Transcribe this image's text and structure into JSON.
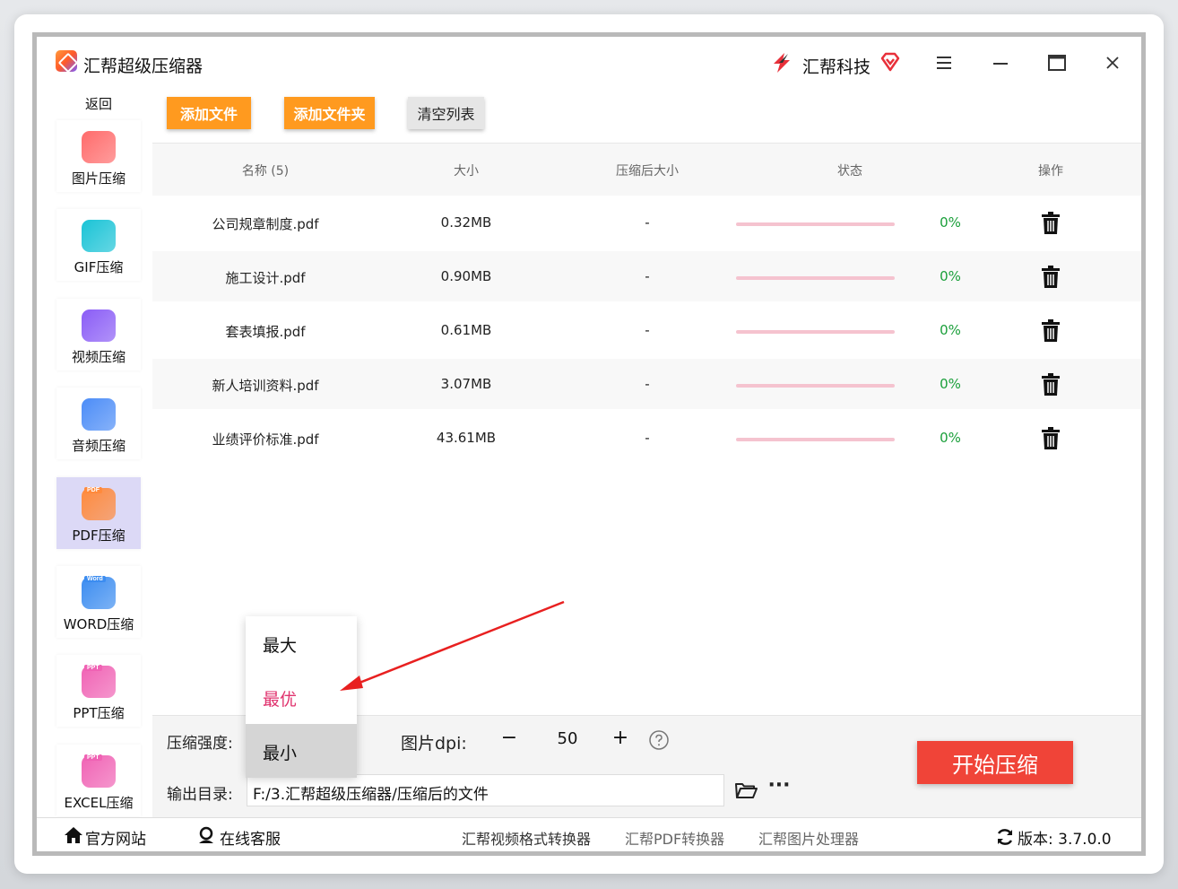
{
  "app": {
    "title": "汇帮超级压缩器",
    "brand": "汇帮科技"
  },
  "sidebar": {
    "back": "返回",
    "items": [
      {
        "label": "图片压缩",
        "icon": "image-icon",
        "color": "#ff6b6b",
        "tag": ""
      },
      {
        "label": "GIF压缩",
        "icon": "gif-icon",
        "color": "#19c3d6",
        "tag": ""
      },
      {
        "label": "视频压缩",
        "icon": "video-icon",
        "color": "#8a5cf6",
        "tag": ""
      },
      {
        "label": "音频压缩",
        "icon": "audio-icon",
        "color": "#4b8cf7",
        "tag": ""
      },
      {
        "label": "PDF压缩",
        "icon": "pdf-icon",
        "color": "#ff8a3c",
        "tag": "PDF"
      },
      {
        "label": "WORD压缩",
        "icon": "word-icon",
        "color": "#3b8cf0",
        "tag": "Word"
      },
      {
        "label": "PPT压缩",
        "icon": "ppt-icon",
        "color": "#f062b4",
        "tag": "PPT"
      },
      {
        "label": "EXCEL压缩",
        "icon": "excel-icon",
        "color": "#f062b4",
        "tag": "PPT"
      }
    ]
  },
  "toolbar": {
    "add_file": "添加文件",
    "add_folder": "添加文件夹",
    "clear": "清空列表"
  },
  "table": {
    "headers": {
      "name": "名称 (5)",
      "size": "大小",
      "compressed": "压缩后大小",
      "status": "状态",
      "action": "操作"
    },
    "rows": [
      {
        "name": "公司规章制度.pdf",
        "size": "0.32MB",
        "compressed": "-",
        "percent": "0%"
      },
      {
        "name": "施工设计.pdf",
        "size": "0.90MB",
        "compressed": "-",
        "percent": "0%"
      },
      {
        "name": "套表填报.pdf",
        "size": "0.61MB",
        "compressed": "-",
        "percent": "0%"
      },
      {
        "name": "新人培训资料.pdf",
        "size": "3.07MB",
        "compressed": "-",
        "percent": "0%"
      },
      {
        "name": "业绩评价标准.pdf",
        "size": "43.61MB",
        "compressed": "-",
        "percent": "0%"
      }
    ]
  },
  "settings": {
    "strength_label": "压缩强度:",
    "dpi_label": "图片dpi:",
    "dpi_value": "50",
    "minus": "−",
    "plus": "+",
    "output_label": "输出目录:",
    "output_path": "F:/3.汇帮超级压缩器/压缩后的文件",
    "more": "···",
    "start": "开始压缩"
  },
  "dropdown": {
    "options": [
      {
        "label": "最大",
        "state": "normal"
      },
      {
        "label": "最优",
        "state": "highlight"
      },
      {
        "label": "最小",
        "state": "selected"
      }
    ]
  },
  "footer": {
    "website": "官方网站",
    "support": "在线客服",
    "link1": "汇帮视频格式转换器",
    "link2": "汇帮PDF转换器",
    "link3": "汇帮图片处理器",
    "version": "版本: 3.7.0.0"
  },
  "colors": {
    "accent_orange": "#ff9a1f",
    "start_red": "#f04438",
    "percent_green": "#1a9f3a",
    "progress_pink": "#f5c3cf",
    "active_sidebar": "#dcd9f6"
  }
}
